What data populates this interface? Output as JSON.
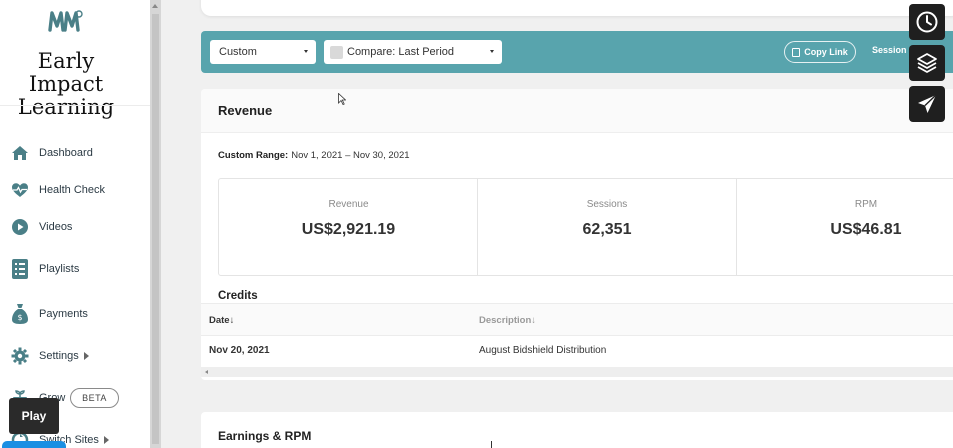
{
  "brand": {
    "name": "Early Impact Learning"
  },
  "sidebar": {
    "items": [
      {
        "label": "Dashboard",
        "icon": "home-icon"
      },
      {
        "label": "Health Check",
        "icon": "heartbeat-icon"
      },
      {
        "label": "Videos",
        "icon": "play-circle-icon"
      },
      {
        "label": "Playlists",
        "icon": "list-icon"
      },
      {
        "label": "Payments",
        "icon": "money-bag-icon"
      },
      {
        "label": "Settings",
        "icon": "gear-icon"
      },
      {
        "label": "Grow",
        "icon": "grow-icon",
        "badge": "BETA"
      },
      {
        "label": "Switch Sites",
        "icon": "switch-icon"
      }
    ],
    "accent_color": "#4a7f87"
  },
  "overlay": {
    "play_label": "Play"
  },
  "filters": {
    "date_select": "Custom",
    "compare_select": "Compare: Last Period",
    "copy_link_label": "Copy Link",
    "sessions_label": "Session"
  },
  "revenue": {
    "title": "Revenue",
    "range_label": "Custom Range:",
    "range_value": "Nov 1, 2021 – Nov 30, 2021",
    "metrics": [
      {
        "label": "Revenue",
        "value": "US$2,921.19"
      },
      {
        "label": "Sessions",
        "value": "62,351"
      },
      {
        "label": "RPM",
        "value": "US$46.81"
      }
    ]
  },
  "credits": {
    "title": "Credits",
    "columns": [
      "Date↓",
      "Description↓"
    ],
    "rows": [
      {
        "date": "Nov 20, 2021",
        "description": "August Bidshield Distribution"
      }
    ]
  },
  "earnings": {
    "title": "Earnings & RPM"
  },
  "colors": {
    "filter_bar": "#58a4ad",
    "tool_button": "#1f1f1f"
  }
}
